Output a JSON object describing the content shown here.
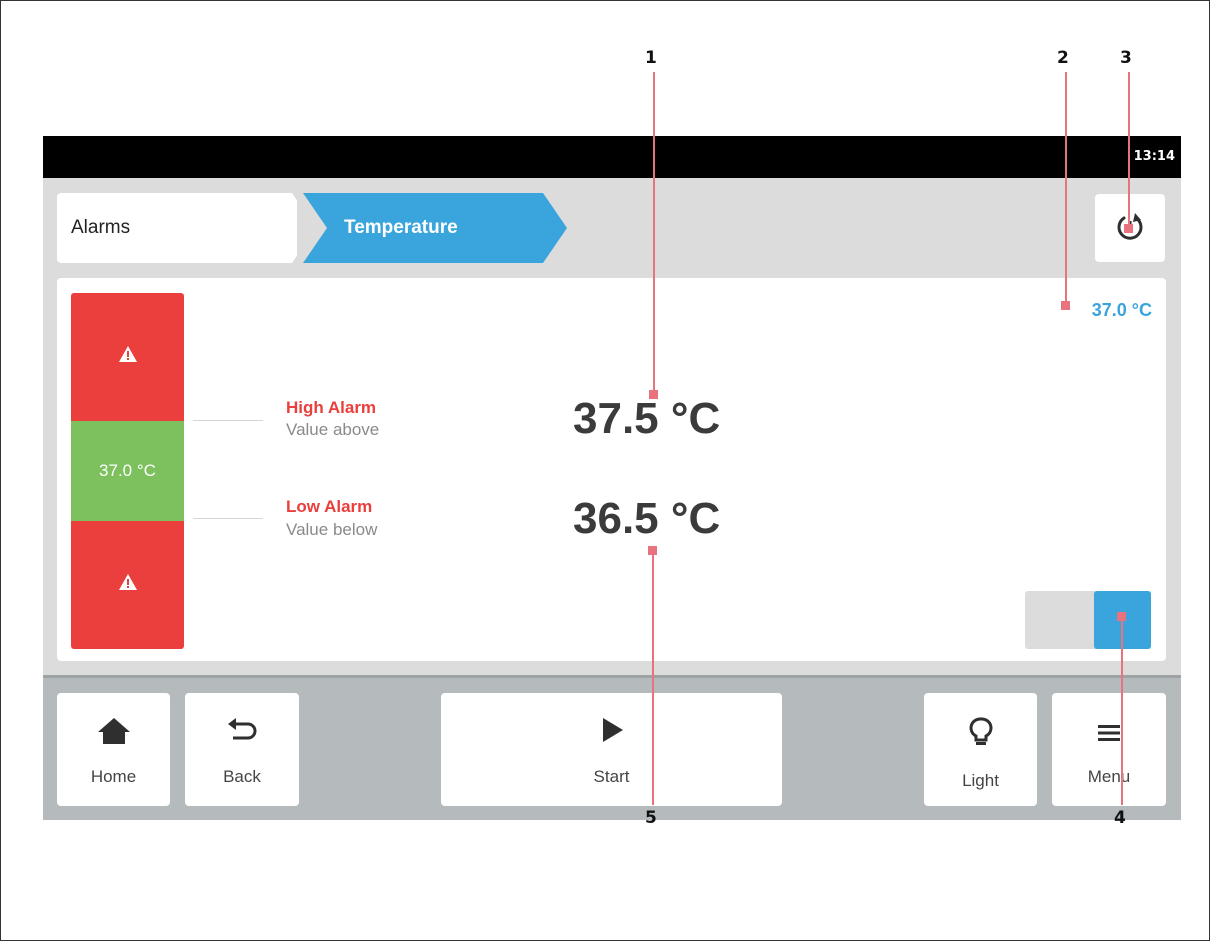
{
  "status_bar": {
    "time": "13:14"
  },
  "breadcrumb": {
    "items": [
      "Alarms",
      "Temperature"
    ]
  },
  "indicator": {
    "current_value": "37.0 °C",
    "bar_value": "37.0 °C"
  },
  "alarms": {
    "high": {
      "title": "High Alarm",
      "subtitle": "Value above",
      "value": "37.5 °C"
    },
    "low": {
      "title": "Low Alarm",
      "subtitle": "Value below",
      "value": "36.5 °C"
    }
  },
  "toggle": {
    "state": "on"
  },
  "nav": {
    "home": "Home",
    "back": "Back",
    "start": "Start",
    "light": "Light",
    "menu": "Menu"
  },
  "callouts": [
    "1",
    "2",
    "3",
    "4",
    "5"
  ],
  "colors": {
    "accent": "#3aa5dc",
    "alarm": "#ea3f3c",
    "ok": "#7cc15e",
    "callout": "#e8737e"
  }
}
